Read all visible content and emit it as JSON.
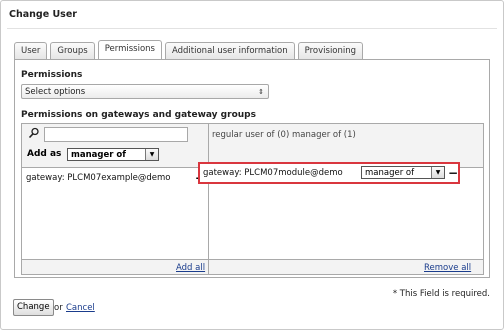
{
  "window": {
    "title": "Change User"
  },
  "tabs": [
    {
      "label": "User"
    },
    {
      "label": "Groups"
    },
    {
      "label": "Permissions",
      "active": true
    },
    {
      "label": "Additional user information"
    },
    {
      "label": "Provisioning"
    }
  ],
  "permissions": {
    "label": "Permissions",
    "select_value": "Select options"
  },
  "gateway_perms": {
    "label": "Permissions on gateways and gateway groups",
    "search_value": "",
    "add_as_label": "Add as",
    "add_as_value": "manager of",
    "available_items": [
      {
        "name": "gateway: PLCM07example@demo",
        "action": "+"
      }
    ],
    "add_all_link": "Add all",
    "summary": {
      "regular_text": "regular user of",
      "regular_count": "(0)",
      "manager_text": "manager of",
      "manager_count": "(1)"
    },
    "assigned_items": [
      {
        "name": "gateway: PLCM07module@demo",
        "role": "manager of",
        "action": "−"
      }
    ],
    "remove_all_link": "Remove all"
  },
  "footer": {
    "required_note": "* This Field is required.",
    "change_button": "Change",
    "or_text": "or",
    "cancel_link": "Cancel"
  },
  "colors": {
    "highlight": "#d9363e",
    "link": "#1a3c8c"
  },
  "icons": {
    "search": "magnifier",
    "dropdown": "triangle-down",
    "select": "up-down-arrows"
  }
}
